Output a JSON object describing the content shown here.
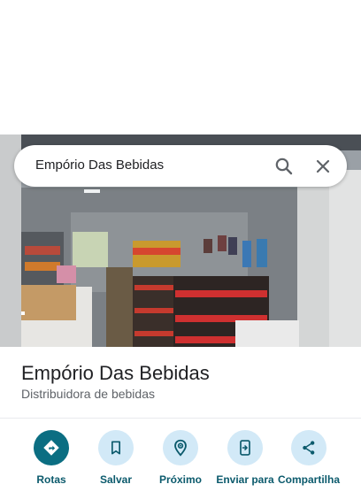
{
  "search": {
    "query": "Empório Das Bebidas"
  },
  "place": {
    "name": "Empório Das Bebidas",
    "category": "Distribuidora de bebidas"
  },
  "actions": [
    {
      "label": "Rotas",
      "icon": "directions-icon"
    },
    {
      "label": "Salvar",
      "icon": "bookmark-icon"
    },
    {
      "label": "Próximo",
      "icon": "nearby-icon"
    },
    {
      "label": "Enviar para",
      "icon": "send-to-phone-icon"
    },
    {
      "label": "Compartilha",
      "icon": "share-icon"
    }
  ],
  "colors": {
    "primary_action": "#0b6e82",
    "action_bg": "#d2e9f7",
    "action_text": "#0b5a6c"
  }
}
